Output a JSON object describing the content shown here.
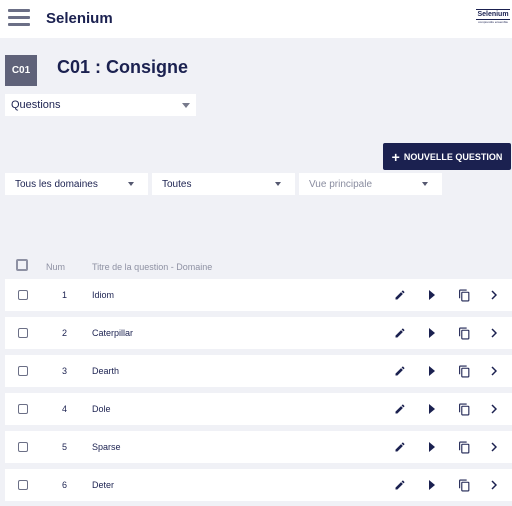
{
  "header": {
    "brand": "Selenium",
    "logo_text": "Selenium",
    "logo_subtext": "comprendre ensemble"
  },
  "page": {
    "code": "C01",
    "title": "C01 : Consigne"
  },
  "section_select": {
    "value": "Questions"
  },
  "new_question_button": {
    "label": "NOUVELLE QUESTION"
  },
  "filters": {
    "domain": "Tous les domaines",
    "status": "Toutes",
    "view_placeholder": "Vue principale"
  },
  "table": {
    "columns": {
      "num": "Num",
      "title": "Titre de la question - Domaine"
    },
    "rows": [
      {
        "num": "1",
        "title": "Idiom"
      },
      {
        "num": "2",
        "title": "Caterpillar"
      },
      {
        "num": "3",
        "title": "Dearth"
      },
      {
        "num": "4",
        "title": "Dole"
      },
      {
        "num": "5",
        "title": "Sparse"
      },
      {
        "num": "6",
        "title": "Deter"
      }
    ]
  },
  "icons": {
    "menu": "hamburger-menu-icon",
    "edit": "pencil-icon",
    "play": "play-icon",
    "copy": "copy-icon",
    "more": "chevron-right-icon"
  },
  "colors": {
    "primary": "#1b2150",
    "badge": "#5f6279",
    "background": "#f0f1f6",
    "muted": "#8e91a3"
  }
}
